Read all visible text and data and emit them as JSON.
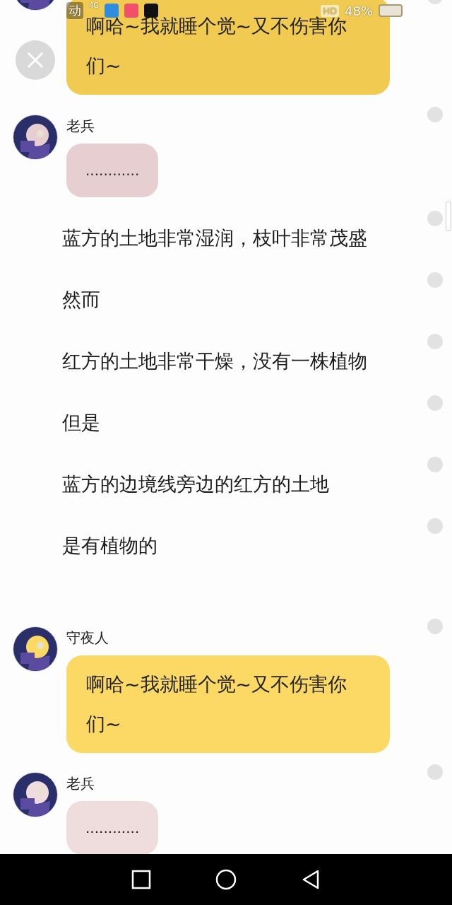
{
  "status_bar": {
    "carrier": "动",
    "network": "4G",
    "badge": "HD",
    "battery": "48%"
  },
  "messages": [
    {
      "kind": "chat",
      "text": "啊哈~我就睡个觉~又不伤害你们~",
      "color": "#f1ca52"
    },
    {
      "kind": "chat",
      "sender": "老兵",
      "text": "............",
      "color": "#e6ced1"
    },
    {
      "kind": "line",
      "text": "蓝方的土地非常湿润，枝叶非常茂盛"
    },
    {
      "kind": "line",
      "text": "然而"
    },
    {
      "kind": "line",
      "text": "红方的土地非常干燥，没有一株植物"
    },
    {
      "kind": "line",
      "text": "但是"
    },
    {
      "kind": "line",
      "text": "蓝方的边境线旁边的红方的土地"
    },
    {
      "kind": "line",
      "text": "是有植物的"
    },
    {
      "kind": "chat",
      "sender": "守夜人",
      "text": "啊哈~我就睡个觉~又不伤害你们~",
      "color": "#fcd865"
    },
    {
      "kind": "chat",
      "sender": "老兵",
      "text": "............",
      "color": "#efdcdd"
    }
  ]
}
